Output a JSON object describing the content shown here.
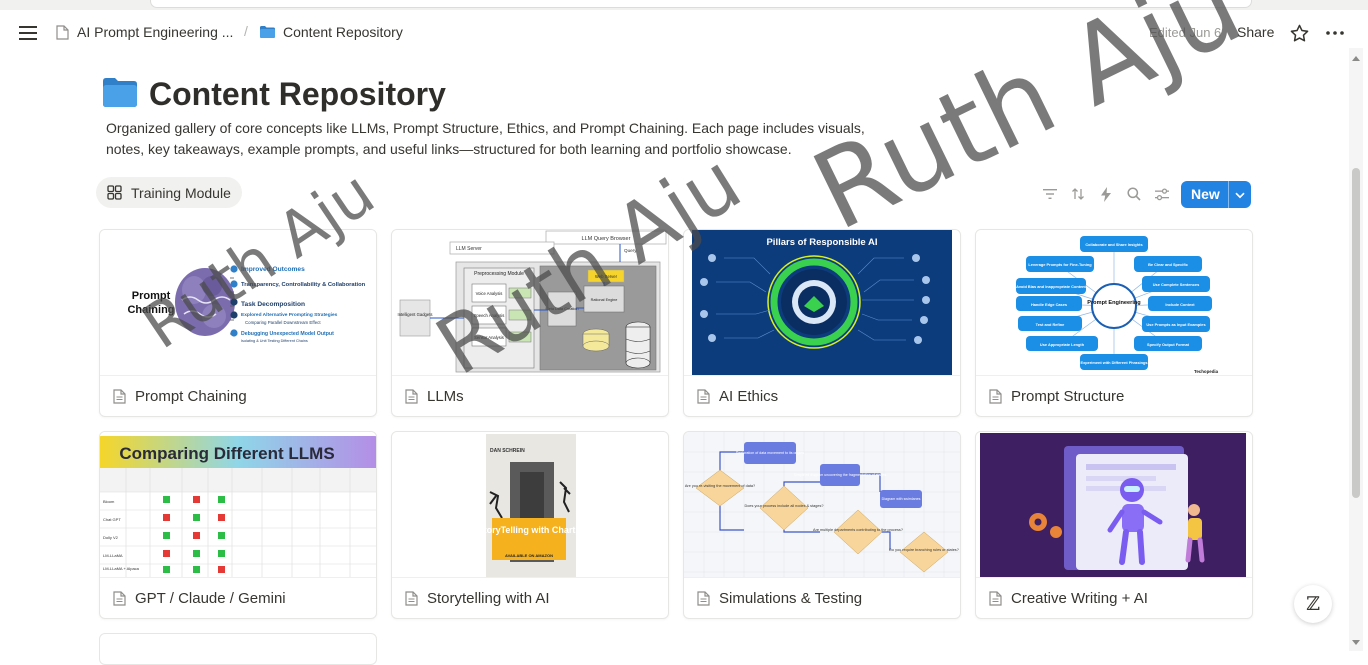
{
  "breadcrumb": {
    "parent": "AI Prompt Engineering ...",
    "separator": "/",
    "current": "Content Repository"
  },
  "header": {
    "edited": "Edited Jun 6",
    "share": "Share"
  },
  "page": {
    "title": "Content Repository",
    "description": "Organized gallery of core concepts like LLMs, Prompt Structure, Ethics, and Prompt Chaining. Each page includes visuals, notes, key takeaways, example prompts, and useful links—structured for both learning and portfolio showcase."
  },
  "view": {
    "tab_label": "Training Module",
    "new_button": "New"
  },
  "cards": [
    {
      "title": "Prompt Chaining",
      "cover": "prompt-chaining-diagram"
    },
    {
      "title": "LLMs",
      "cover": "llm-architecture-diagram"
    },
    {
      "title": "AI Ethics",
      "cover": "pillars-of-responsible-ai"
    },
    {
      "title": "Prompt Structure",
      "cover": "prompt-engineering-mindmap"
    },
    {
      "title": "GPT / Claude / Gemini",
      "cover": "comparing-llms-table"
    },
    {
      "title": "Storytelling with AI",
      "cover": "storytelling-book-cover"
    },
    {
      "title": "Simulations & Testing",
      "cover": "flowchart-diagram"
    },
    {
      "title": "Creative Writing + AI",
      "cover": "robot-illustration"
    }
  ],
  "covers": {
    "prompt_chaining": {
      "heading": "Prompt Chaining",
      "points": [
        "Improved Outcomes",
        "Transparency, Controllability & Collaboration",
        "Task Decomposition",
        "Explored Alternative Prompting Strategies",
        "Comparing Parallel Downstream Effect",
        "Debugging Unexpected Model Output",
        "Isolating & Unit Testing Different Chains"
      ]
    },
    "llms": {
      "labels": [
        "LLM Query Browser",
        "LLM Server",
        "Query",
        "Preprocessing Module",
        "Voice Analysis",
        "Speech Analysis",
        "Sensor Analysis",
        "Intelligent Gadgets",
        "Web Server",
        "Meta Data Creation",
        "Rational Engine"
      ]
    },
    "ethics": {
      "heading": "Pillars of Responsible AI"
    },
    "prompt_structure": {
      "center": "Prompt Engineering",
      "nodes": [
        "Collaborate and Share Insights",
        "Leverage Prompts for Fine-Tuning",
        "Be Clear and Specific",
        "Avoid Bias and Inappropriate Content",
        "Use Complete Sentences",
        "Handle Edge Cases",
        "Include Context",
        "Test and Refine",
        "Use Prompts as Input Examples",
        "Use Appropriate Length",
        "Specify Output Format",
        "Experiment with Different Phrasings"
      ],
      "credit": "Techopedia"
    },
    "compare": {
      "heading": "Comparing Different LLMS",
      "rows": [
        "Bloom",
        "Chat GPT",
        "Dolly V2",
        "LM-LLaMA",
        "LM-LLaMA + Alpaca"
      ]
    },
    "storytelling": {
      "author": "DAN SCHREIN",
      "title": "StoryTelling with Charts",
      "sub": "AVAILABLE ON AMAZON"
    },
    "simulations": {
      "steps": [
        "Are you re-visiting the movement of data?",
        "Restoration of data movement to its origins",
        "Does your process include all nodes & stages?",
        "Simplified diagram uncovering the fragmentation of stages",
        "Are multiple departments contributing to the process?",
        "Diagram with swimlanes",
        "Do you require branching rules or states?"
      ]
    }
  },
  "watermarks": [
    "Ruth Aju",
    "Ruth Aju",
    "Ruth Aju"
  ],
  "colors": {
    "accent": "#2383e2",
    "text": "#37352f",
    "muted": "#9b9a97",
    "folder": "#4aa1e8",
    "ethics_bg": "#0d3c7d",
    "robot_bg": "#3d1f62"
  }
}
